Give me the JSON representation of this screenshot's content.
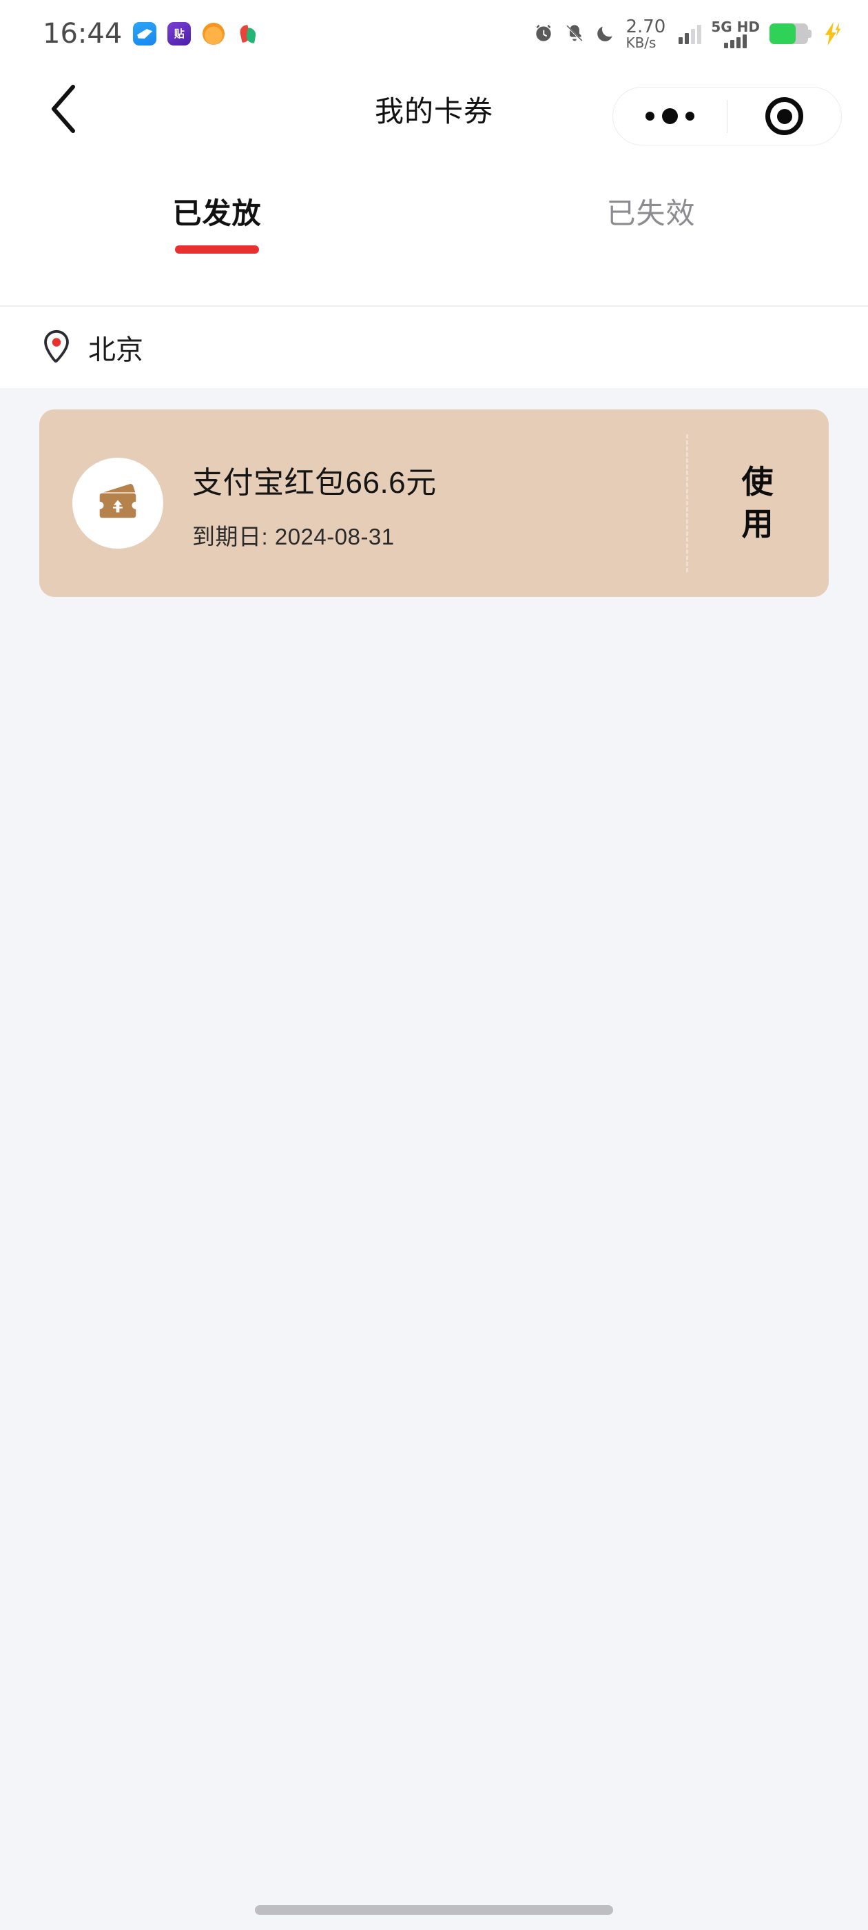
{
  "status_bar": {
    "time": "16:44",
    "app_icons": [
      "wings-app-icon",
      "tie-app-icon",
      "cat-app-icon",
      "leaf-app-icon"
    ],
    "system_icons": [
      "alarm-icon",
      "mute-icon",
      "do-not-disturb-moon-icon"
    ],
    "network_speed_value": "2.70",
    "network_speed_unit": "KB/s",
    "carrier_label_1": "5G",
    "carrier_label_2": "HD",
    "battery_icon": "battery-icon",
    "charging_icon": "charging-bolt-icon"
  },
  "nav": {
    "back_icon": "back-chevron-icon",
    "title": "我的卡券",
    "capsule": {
      "more_icon": "more-dots-icon",
      "close_icon": "target-circle-icon"
    }
  },
  "tabs": [
    {
      "label": "已发放",
      "active": true
    },
    {
      "label": "已失效",
      "active": false
    }
  ],
  "location": {
    "icon": "location-pin-icon",
    "name": "北京"
  },
  "coupons": [
    {
      "icon": "wallet-yuan-icon",
      "title": "支付宝红包66.6元",
      "expiry": "到期日: 2024-08-31",
      "action_label": "使用"
    }
  ],
  "colors": {
    "accent_red": "#e8312f",
    "coupon_bg": "#e6cdb8",
    "coupon_icon": "#b5824c",
    "page_bg": "#f4f5f9",
    "battery_green": "#2fd157"
  },
  "home_indicator": "home-indicator"
}
